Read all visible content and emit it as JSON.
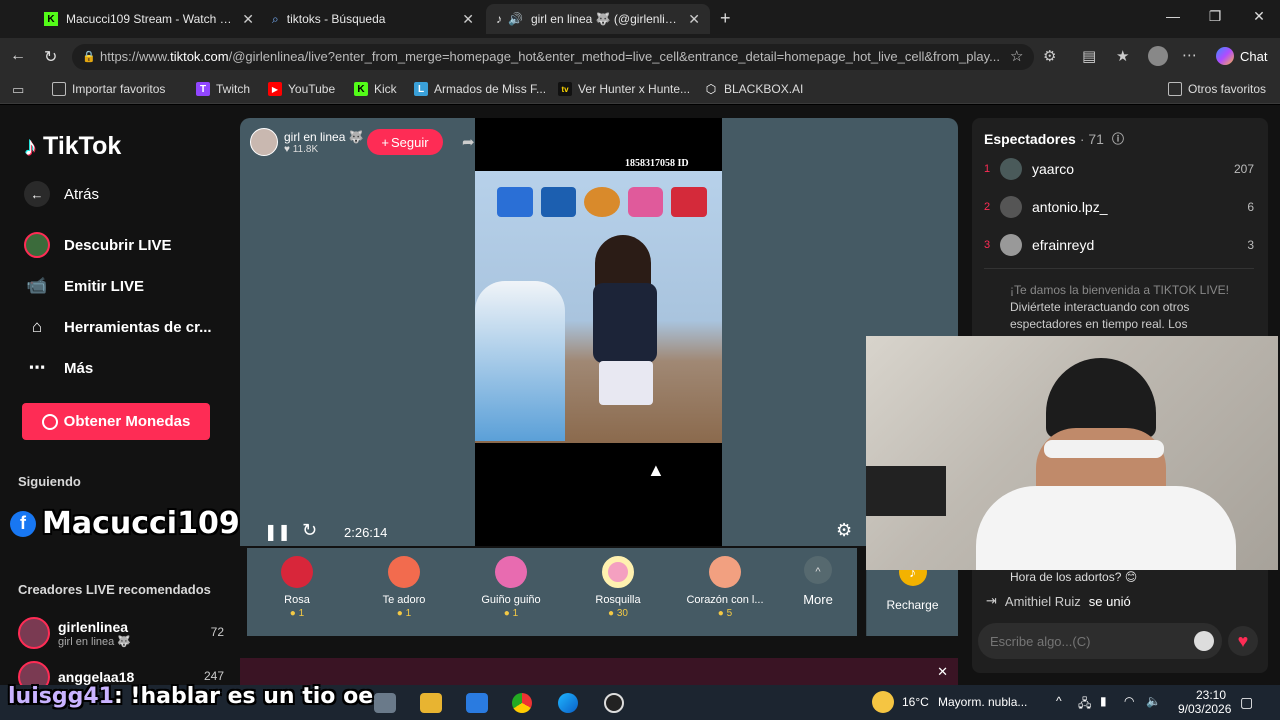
{
  "browser": {
    "tabs": [
      {
        "title": "Macucci109 Stream - Watch Live o",
        "favicon": "K"
      },
      {
        "title": "tiktoks - Búsqueda",
        "favicon": "search"
      },
      {
        "title": "girl en linea 🐺 (@girlenlinea)",
        "favicon": "tiktok"
      }
    ],
    "url_prefix": "https://www.",
    "url_host": "tiktok.com",
    "url_rest": "/@girlenlinea/live?enter_from_merge=homepage_hot&enter_method=live_cell&entrance_detail=homepage_hot_live_cell&from_play...",
    "chat_label": "Chat",
    "bookmarks": [
      "Importar favoritos",
      "Twitch",
      "YouTube",
      "Kick",
      "Armados de Miss F...",
      "Ver Hunter x Hunte...",
      "BLACKBOX.AI"
    ],
    "bookmark_icons": [
      "",
      "T",
      "▶",
      "K",
      "L",
      "tv",
      "⬡"
    ],
    "other_favorites": "Otros favoritos"
  },
  "sidebar": {
    "logo": "TikTok",
    "back": "Atrás",
    "nav": [
      "Descubrir LIVE",
      "Emitir LIVE",
      "Herramientas de cr...",
      "Más"
    ],
    "coins_button": "Obtener Monedas",
    "following_title": "Siguiendo",
    "recommended_title": "Creadores LIVE recomendados",
    "creators": [
      {
        "name": "girlenlinea",
        "sub": "girl en linea 🐺",
        "count": "72"
      },
      {
        "name": "anggelaa18",
        "sub": "",
        "count": "247"
      }
    ]
  },
  "stream": {
    "host_name": "girl en linea 🐺",
    "host_likes": "11.8K",
    "follow_label": "Seguir",
    "video_id": "1858317058 ID",
    "timer": "2:26:14"
  },
  "gifts": [
    {
      "name": "Rosa",
      "price": "1",
      "color": "#d8263a"
    },
    {
      "name": "Te adoro",
      "price": "1",
      "color": "#f26b4e"
    },
    {
      "name": "Guiño guiño",
      "price": "1",
      "color": "#e86bb0"
    },
    {
      "name": "Rosquilla",
      "price": "30",
      "color": "#f4a0c0"
    },
    {
      "name": "Corazón con l...",
      "price": "5",
      "color": "#f2a080"
    }
  ],
  "gift_more": "More",
  "recharge": "Recharge",
  "right_panel": {
    "viewers_title": "Espectadores",
    "viewers_count": "· 71",
    "viewers": [
      {
        "rank": "1",
        "name": "yaarco",
        "score": "207"
      },
      {
        "rank": "2",
        "name": "antonio.lpz_",
        "score": "6"
      },
      {
        "rank": "3",
        "name": "efrainreyd",
        "score": "3"
      }
    ],
    "welcome_1": "¡Te damos la bienvenida a TIKTOK LIVE!",
    "welcome_2": "Diviértete interactuando con otros",
    "welcome_3": "espectadores en tiempo real. Los",
    "chat_line": "Hora de los adortos? 😊",
    "join_user": "Amithiel Ruiz",
    "join_text": "se unió",
    "input_placeholder": "Escribe algo...(C)"
  },
  "overlay": {
    "streamer_name": "Macucci109",
    "chat_user": "luisgg41",
    "chat_text": ": !hablar es un tio oe"
  },
  "taskbar": {
    "temp": "16°C",
    "weather": "Mayorm. nubla...",
    "time": "23:10",
    "date": "9/03/2026"
  }
}
